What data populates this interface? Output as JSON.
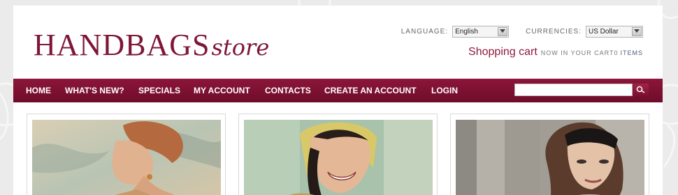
{
  "logo": {
    "main": "HANDBAGS",
    "sub": "store"
  },
  "settings": {
    "language_label": "LANGUAGE:",
    "language_value": "English",
    "currency_label": "CURRENCIES:",
    "currency_value": "US Dollar"
  },
  "cart": {
    "title": "Shopping cart",
    "text": "NOW IN YOUR CART",
    "count": "0",
    "items_link": "ITEMS"
  },
  "nav": {
    "items": [
      "HOME",
      "WHAT'S NEW?",
      "SPECIALS",
      "MY ACCOUNT",
      "CONTACTS",
      "CREATE AN ACCOUNT",
      "LOGIN"
    ]
  },
  "search": {
    "placeholder": "",
    "icon": "search-icon"
  },
  "products": [
    {
      "image": "woman-with-earrings-photo"
    },
    {
      "image": "smiling-woman-in-headscarf-photo"
    },
    {
      "image": "woman-with-headband-photo"
    }
  ],
  "colors": {
    "accent": "#7e1737",
    "nav": "#7a0f30",
    "background": "#ebebeb"
  }
}
